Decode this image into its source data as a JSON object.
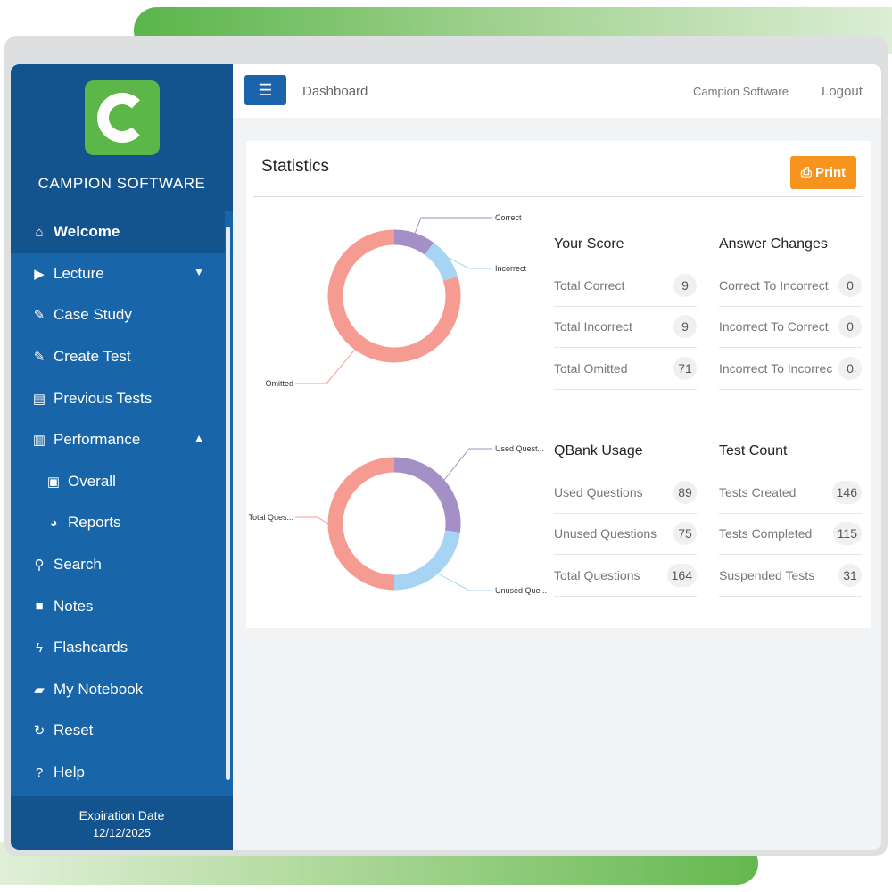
{
  "brand": {
    "name": "CAMPION SOFTWARE",
    "logo_letter": "C"
  },
  "sidebar": {
    "items": [
      {
        "label": "Welcome",
        "icon": "home-icon"
      },
      {
        "label": "Lecture",
        "icon": "video-icon"
      },
      {
        "label": "Case Study",
        "icon": "edit-icon"
      },
      {
        "label": "Create Test",
        "icon": "edit-icon"
      },
      {
        "label": "Previous Tests",
        "icon": "file-icon"
      },
      {
        "label": "Performance",
        "icon": "bar-chart-icon"
      },
      {
        "label": "Overall",
        "icon": "file-chart-icon"
      },
      {
        "label": "Reports",
        "icon": "pie-chart-icon"
      },
      {
        "label": "Search",
        "icon": "search-icon"
      },
      {
        "label": "Notes",
        "icon": "sticky-note-icon"
      },
      {
        "label": "Flashcards",
        "icon": "bolt-icon"
      },
      {
        "label": "My Notebook",
        "icon": "book-icon"
      },
      {
        "label": "Reset",
        "icon": "reset-icon"
      },
      {
        "label": "Help",
        "icon": "help-icon"
      }
    ],
    "expiration_label": "Expiration Date",
    "expiration_value": "12/12/2025"
  },
  "topbar": {
    "breadcrumb": "Dashboard",
    "company": "Campion Software",
    "logout": "Logout"
  },
  "panel": {
    "title": "Statistics",
    "print_label": "Print"
  },
  "charts": {
    "score_donut": {
      "labels": [
        "Correct",
        "Incorrect",
        "Omitted"
      ],
      "values": [
        9,
        9,
        71
      ],
      "colors": [
        "#a58fc7",
        "#a6d4f2",
        "#f59b91"
      ]
    },
    "usage_donut": {
      "labels": [
        "Used Quest...",
        "Unused Que...",
        "Total Ques..."
      ],
      "values": [
        89,
        75,
        164
      ],
      "colors": [
        "#a58fc7",
        "#a6d4f2",
        "#f59b91"
      ]
    }
  },
  "stats": {
    "your_score": {
      "title": "Your Score",
      "rows": [
        {
          "label": "Total Correct",
          "value": "9"
        },
        {
          "label": "Total Incorrect",
          "value": "9"
        },
        {
          "label": "Total Omitted",
          "value": "71"
        }
      ]
    },
    "answer_changes": {
      "title": "Answer Changes",
      "rows": [
        {
          "label": "Correct To Incorrect",
          "value": "0"
        },
        {
          "label": "Incorrect To Correct",
          "value": "0"
        },
        {
          "label": "Incorrect To Incorrec",
          "value": "0"
        }
      ]
    },
    "qbank_usage": {
      "title": "QBank Usage",
      "rows": [
        {
          "label": "Used Questions",
          "value": "89"
        },
        {
          "label": "Unused Questions",
          "value": "75"
        },
        {
          "label": "Total Questions",
          "value": "164"
        }
      ]
    },
    "test_count": {
      "title": "Test Count",
      "rows": [
        {
          "label": "Tests Created",
          "value": "146"
        },
        {
          "label": "Tests Completed",
          "value": "115"
        },
        {
          "label": "Suspended Tests",
          "value": "31"
        }
      ]
    }
  }
}
